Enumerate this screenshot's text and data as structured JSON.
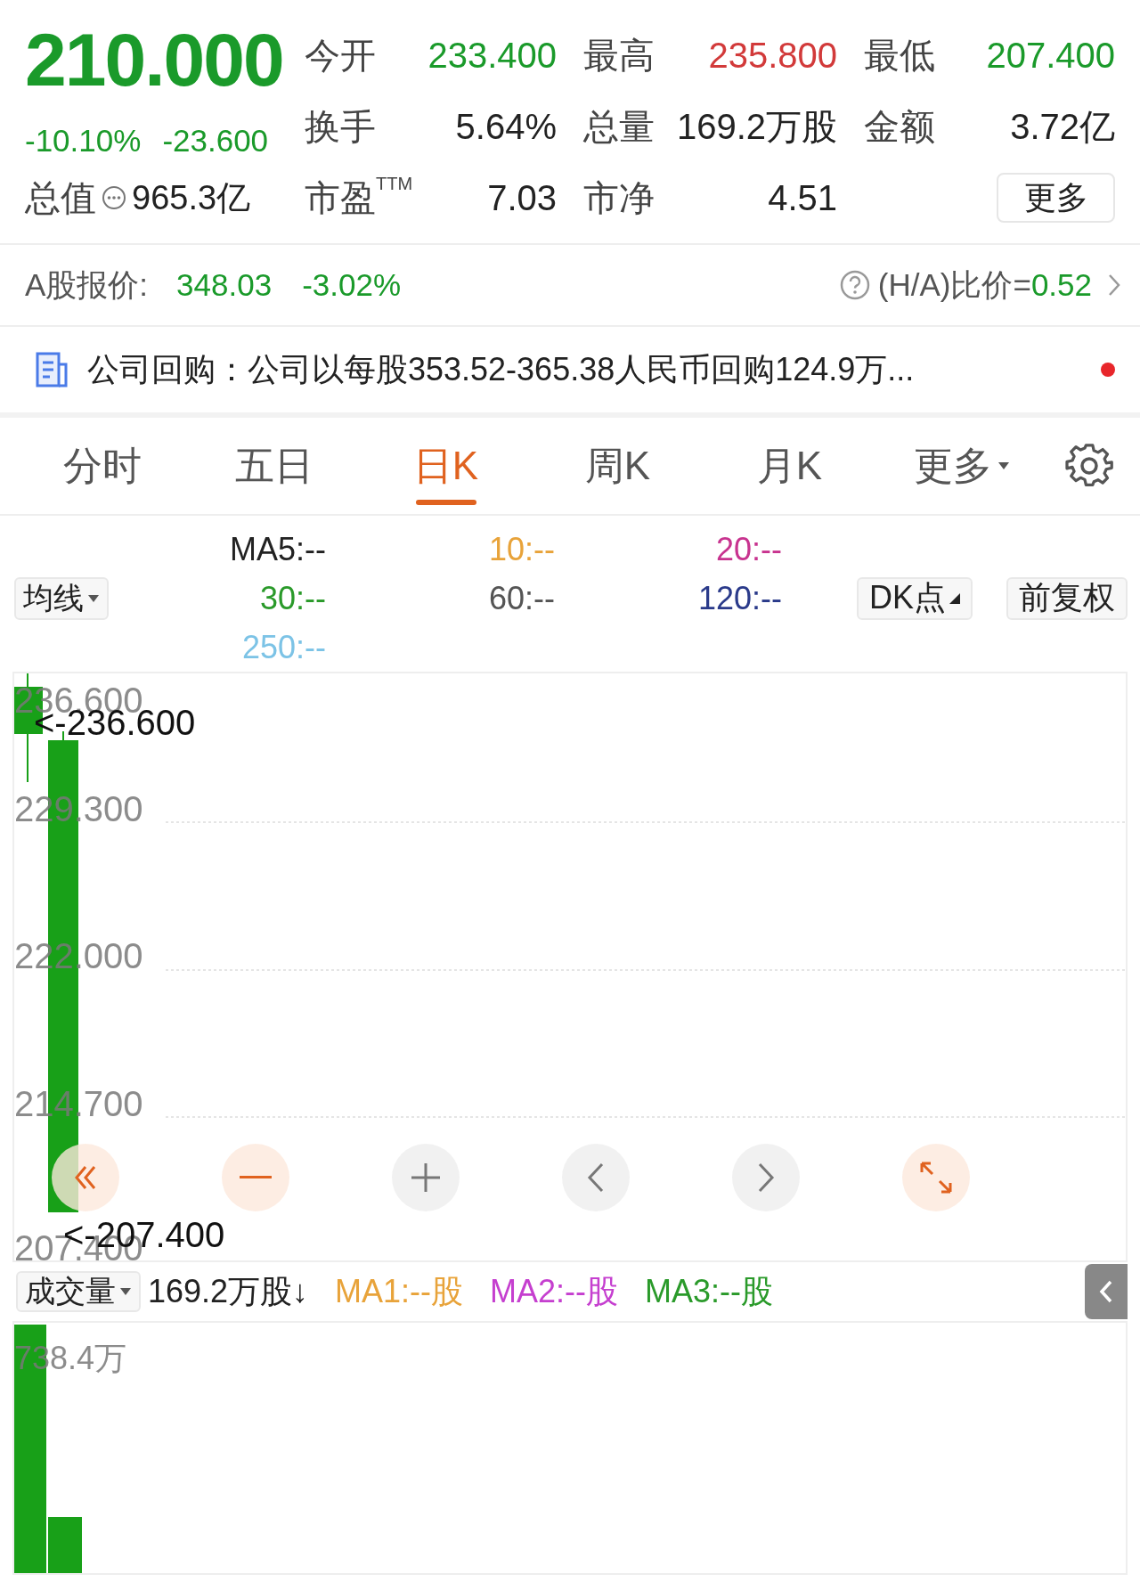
{
  "quote": {
    "price": "210.000",
    "change_pct": "-10.10%",
    "change": "-23.600",
    "color": "#1a9a2a"
  },
  "stats": [
    {
      "label": "今开",
      "value": "233.400",
      "color": "#1a9a2a"
    },
    {
      "label": "最高",
      "value": "235.800",
      "color": "#d23a3a"
    },
    {
      "label": "最低",
      "value": "207.400",
      "color": "#1a9a2a"
    },
    {
      "label": "换手",
      "value": "5.64%",
      "color": "#222222"
    },
    {
      "label": "总量",
      "value": "169.2万股",
      "color": "#222222"
    },
    {
      "label": "金额",
      "value": "3.72亿",
      "color": "#222222"
    },
    {
      "label": "市盈",
      "sup": "TTM",
      "value": "7.03",
      "color": "#222222"
    },
    {
      "label": "市净",
      "value": "4.51",
      "color": "#222222"
    }
  ],
  "market_cap": {
    "label": "总值",
    "value": "965.3亿"
  },
  "more_button": "更多",
  "a_share": {
    "label": "A股报价:",
    "price": "348.03",
    "change": "-3.02%",
    "color": "#1a9a2a",
    "ratio_label": "(H/A)比价=",
    "ratio": "0.52"
  },
  "announcement": {
    "text": "公司回购：公司以每股353.52-365.38人民币回购124.9万...",
    "unread": true
  },
  "tabs": [
    {
      "label": "分时",
      "selected": false
    },
    {
      "label": "五日",
      "selected": false
    },
    {
      "label": "日K",
      "selected": true
    },
    {
      "label": "周K",
      "selected": false
    },
    {
      "label": "月K",
      "selected": false
    },
    {
      "label": "更多",
      "selected": false,
      "kind": "dropdown"
    }
  ],
  "ma_selector": "均线",
  "moving_averages": [
    {
      "label": "MA5:--",
      "color": "#222222"
    },
    {
      "label": "10:--",
      "color": "#e8a33a"
    },
    {
      "label": "20:--",
      "color": "#c8338f"
    },
    {
      "label": "30:--",
      "color": "#2a9a2a"
    },
    {
      "label": "60:--",
      "color": "#555555"
    },
    {
      "label": "120:--",
      "color": "#2a3a8a"
    },
    {
      "label": "250:--",
      "color": "#7cc3e6"
    }
  ],
  "dk_button": "DK点",
  "adjust_button": "前复权",
  "price_chart": {
    "y_labels": [
      "236.600",
      "229.300",
      "222.000",
      "214.700",
      "207.400"
    ],
    "high_marker": "<-236.600",
    "low_marker": "<-207.400"
  },
  "volume": {
    "selector": "成交量",
    "value": "169.2万股↓",
    "averages": [
      {
        "label": "MA1:--股",
        "color": "#e8a33a"
      },
      {
        "label": "MA2:--股",
        "color": "#c53fcf"
      },
      {
        "label": "MA3:--股",
        "color": "#2a9a2a"
      }
    ],
    "max_label": "738.4万"
  }
}
